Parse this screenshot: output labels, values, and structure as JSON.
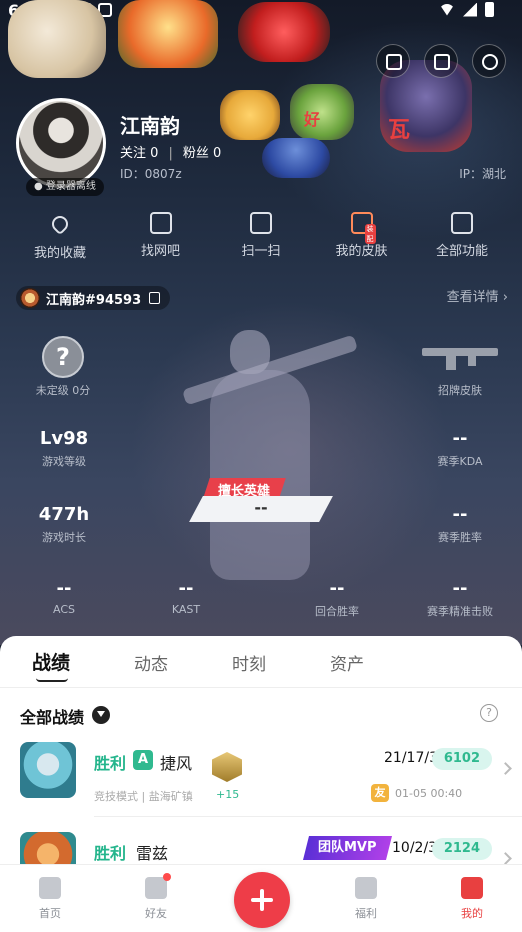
{
  "status_bar": {
    "time": "6:24"
  },
  "profile": {
    "nickname": "江南韵",
    "follow_label": "关注",
    "follow_count": "0",
    "fans_label": "粉丝",
    "fans_count": "0",
    "uid": "ID：0807z",
    "ip": "IP：湖北",
    "online_status": "● 登录器离线"
  },
  "stickers": {
    "label1": "好",
    "label2": "瓦"
  },
  "shortcuts": [
    {
      "label": "我的收藏",
      "icon": "heart-icon"
    },
    {
      "label": "找网吧",
      "icon": "monitor-icon"
    },
    {
      "label": "扫一扫",
      "icon": "scan-icon"
    },
    {
      "label": "我的皮肤",
      "icon": "skin-icon",
      "tag": "装配"
    },
    {
      "label": "全部功能",
      "icon": "grid-icon"
    }
  ],
  "game_account": {
    "name": "江南韵#94593",
    "details_link": "查看详情 ›"
  },
  "stats": {
    "rank_symbol": "?",
    "rank_label": "未定级 0分",
    "skin_label": "招牌皮肤",
    "level_value": "Lv98",
    "level_label": "游戏等级",
    "kda_value": "--",
    "kda_label": "赛季KDA",
    "time_value": "477h",
    "time_label": "游戏时长",
    "winrate_value": "--",
    "winrate_label": "赛季胜率",
    "best_hero_tag": "擅长英雄",
    "best_hero_value": "--",
    "acs_value": "--",
    "acs_label": "ACS",
    "kast_value": "--",
    "kast_label": "KAST",
    "round_win_value": "--",
    "round_win_label": "回合胜率",
    "headshot_value": "--",
    "headshot_label": "赛季精准击败"
  },
  "tabs": [
    {
      "label": "战绩",
      "active": true
    },
    {
      "label": "动态"
    },
    {
      "label": "时刻"
    },
    {
      "label": "资产"
    }
  ],
  "records": {
    "section_title": "全部战绩",
    "help_symbol": "?",
    "matches": [
      {
        "result": "胜利",
        "mode_badge": "A",
        "agent": "捷风",
        "mode_map": "竞技模式 | 盐海矿镇",
        "rank_delta": "+15",
        "kda": "21/17/3",
        "score": "6102",
        "friend_badge": "友",
        "time": "01-05 00:40"
      },
      {
        "result": "胜利",
        "agent": "雷兹",
        "mvp": "团队MVP",
        "kda": "10/2/3",
        "score": "2124"
      }
    ]
  },
  "bottom_nav": [
    {
      "label": "首页"
    },
    {
      "label": "好友"
    },
    {
      "label": "福利"
    },
    {
      "label": "我的",
      "active": true
    }
  ],
  "colors": {
    "accent": "#e84040",
    "win": "#24b58c",
    "mvp": "#7a36e0"
  }
}
